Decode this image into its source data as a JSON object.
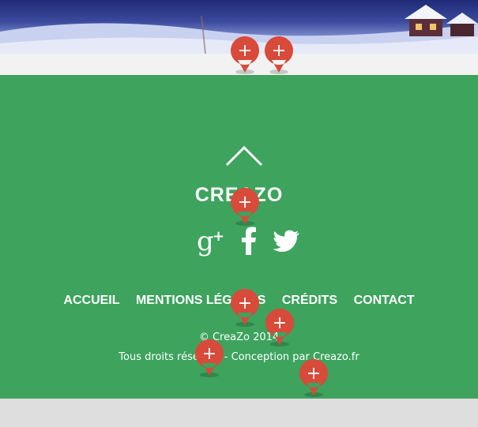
{
  "footer": {
    "brand": "CreaZo",
    "nav": [
      {
        "label": "ACCUEIL"
      },
      {
        "label": "MENTIONS LÉGALES"
      },
      {
        "label": "CRÉDITS"
      },
      {
        "label": "CONTACT"
      }
    ],
    "copyright": "© CreaZo 2014",
    "rights": "Tous droits réservés - Conception par Creazo.fr",
    "social_icons": [
      "google-plus-icon",
      "facebook-icon",
      "twitter-icon"
    ],
    "scroll_top_icon": "chevron-up-icon"
  },
  "pins": {
    "label": "+",
    "count": 8
  },
  "colors": {
    "footer_bg": "#3da35d",
    "pin_red": "#d84a3a",
    "strip_bg": "#f2f2f2",
    "bottom_bg": "#dedede"
  }
}
